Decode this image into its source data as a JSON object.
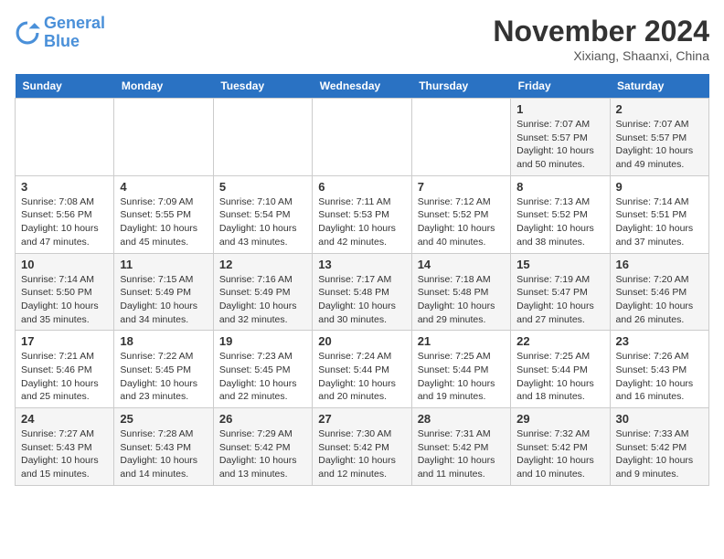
{
  "logo": {
    "line1": "General",
    "line2": "Blue"
  },
  "title": "November 2024",
  "location": "Xixiang, Shaanxi, China",
  "weekdays": [
    "Sunday",
    "Monday",
    "Tuesday",
    "Wednesday",
    "Thursday",
    "Friday",
    "Saturday"
  ],
  "weeks": [
    [
      {
        "day": "",
        "info": ""
      },
      {
        "day": "",
        "info": ""
      },
      {
        "day": "",
        "info": ""
      },
      {
        "day": "",
        "info": ""
      },
      {
        "day": "",
        "info": ""
      },
      {
        "day": "1",
        "info": "Sunrise: 7:07 AM\nSunset: 5:57 PM\nDaylight: 10 hours\nand 50 minutes."
      },
      {
        "day": "2",
        "info": "Sunrise: 7:07 AM\nSunset: 5:57 PM\nDaylight: 10 hours\nand 49 minutes."
      }
    ],
    [
      {
        "day": "3",
        "info": "Sunrise: 7:08 AM\nSunset: 5:56 PM\nDaylight: 10 hours\nand 47 minutes."
      },
      {
        "day": "4",
        "info": "Sunrise: 7:09 AM\nSunset: 5:55 PM\nDaylight: 10 hours\nand 45 minutes."
      },
      {
        "day": "5",
        "info": "Sunrise: 7:10 AM\nSunset: 5:54 PM\nDaylight: 10 hours\nand 43 minutes."
      },
      {
        "day": "6",
        "info": "Sunrise: 7:11 AM\nSunset: 5:53 PM\nDaylight: 10 hours\nand 42 minutes."
      },
      {
        "day": "7",
        "info": "Sunrise: 7:12 AM\nSunset: 5:52 PM\nDaylight: 10 hours\nand 40 minutes."
      },
      {
        "day": "8",
        "info": "Sunrise: 7:13 AM\nSunset: 5:52 PM\nDaylight: 10 hours\nand 38 minutes."
      },
      {
        "day": "9",
        "info": "Sunrise: 7:14 AM\nSunset: 5:51 PM\nDaylight: 10 hours\nand 37 minutes."
      }
    ],
    [
      {
        "day": "10",
        "info": "Sunrise: 7:14 AM\nSunset: 5:50 PM\nDaylight: 10 hours\nand 35 minutes."
      },
      {
        "day": "11",
        "info": "Sunrise: 7:15 AM\nSunset: 5:49 PM\nDaylight: 10 hours\nand 34 minutes."
      },
      {
        "day": "12",
        "info": "Sunrise: 7:16 AM\nSunset: 5:49 PM\nDaylight: 10 hours\nand 32 minutes."
      },
      {
        "day": "13",
        "info": "Sunrise: 7:17 AM\nSunset: 5:48 PM\nDaylight: 10 hours\nand 30 minutes."
      },
      {
        "day": "14",
        "info": "Sunrise: 7:18 AM\nSunset: 5:48 PM\nDaylight: 10 hours\nand 29 minutes."
      },
      {
        "day": "15",
        "info": "Sunrise: 7:19 AM\nSunset: 5:47 PM\nDaylight: 10 hours\nand 27 minutes."
      },
      {
        "day": "16",
        "info": "Sunrise: 7:20 AM\nSunset: 5:46 PM\nDaylight: 10 hours\nand 26 minutes."
      }
    ],
    [
      {
        "day": "17",
        "info": "Sunrise: 7:21 AM\nSunset: 5:46 PM\nDaylight: 10 hours\nand 25 minutes."
      },
      {
        "day": "18",
        "info": "Sunrise: 7:22 AM\nSunset: 5:45 PM\nDaylight: 10 hours\nand 23 minutes."
      },
      {
        "day": "19",
        "info": "Sunrise: 7:23 AM\nSunset: 5:45 PM\nDaylight: 10 hours\nand 22 minutes."
      },
      {
        "day": "20",
        "info": "Sunrise: 7:24 AM\nSunset: 5:44 PM\nDaylight: 10 hours\nand 20 minutes."
      },
      {
        "day": "21",
        "info": "Sunrise: 7:25 AM\nSunset: 5:44 PM\nDaylight: 10 hours\nand 19 minutes."
      },
      {
        "day": "22",
        "info": "Sunrise: 7:25 AM\nSunset: 5:44 PM\nDaylight: 10 hours\nand 18 minutes."
      },
      {
        "day": "23",
        "info": "Sunrise: 7:26 AM\nSunset: 5:43 PM\nDaylight: 10 hours\nand 16 minutes."
      }
    ],
    [
      {
        "day": "24",
        "info": "Sunrise: 7:27 AM\nSunset: 5:43 PM\nDaylight: 10 hours\nand 15 minutes."
      },
      {
        "day": "25",
        "info": "Sunrise: 7:28 AM\nSunset: 5:43 PM\nDaylight: 10 hours\nand 14 minutes."
      },
      {
        "day": "26",
        "info": "Sunrise: 7:29 AM\nSunset: 5:42 PM\nDaylight: 10 hours\nand 13 minutes."
      },
      {
        "day": "27",
        "info": "Sunrise: 7:30 AM\nSunset: 5:42 PM\nDaylight: 10 hours\nand 12 minutes."
      },
      {
        "day": "28",
        "info": "Sunrise: 7:31 AM\nSunset: 5:42 PM\nDaylight: 10 hours\nand 11 minutes."
      },
      {
        "day": "29",
        "info": "Sunrise: 7:32 AM\nSunset: 5:42 PM\nDaylight: 10 hours\nand 10 minutes."
      },
      {
        "day": "30",
        "info": "Sunrise: 7:33 AM\nSunset: 5:42 PM\nDaylight: 10 hours\nand 9 minutes."
      }
    ]
  ]
}
